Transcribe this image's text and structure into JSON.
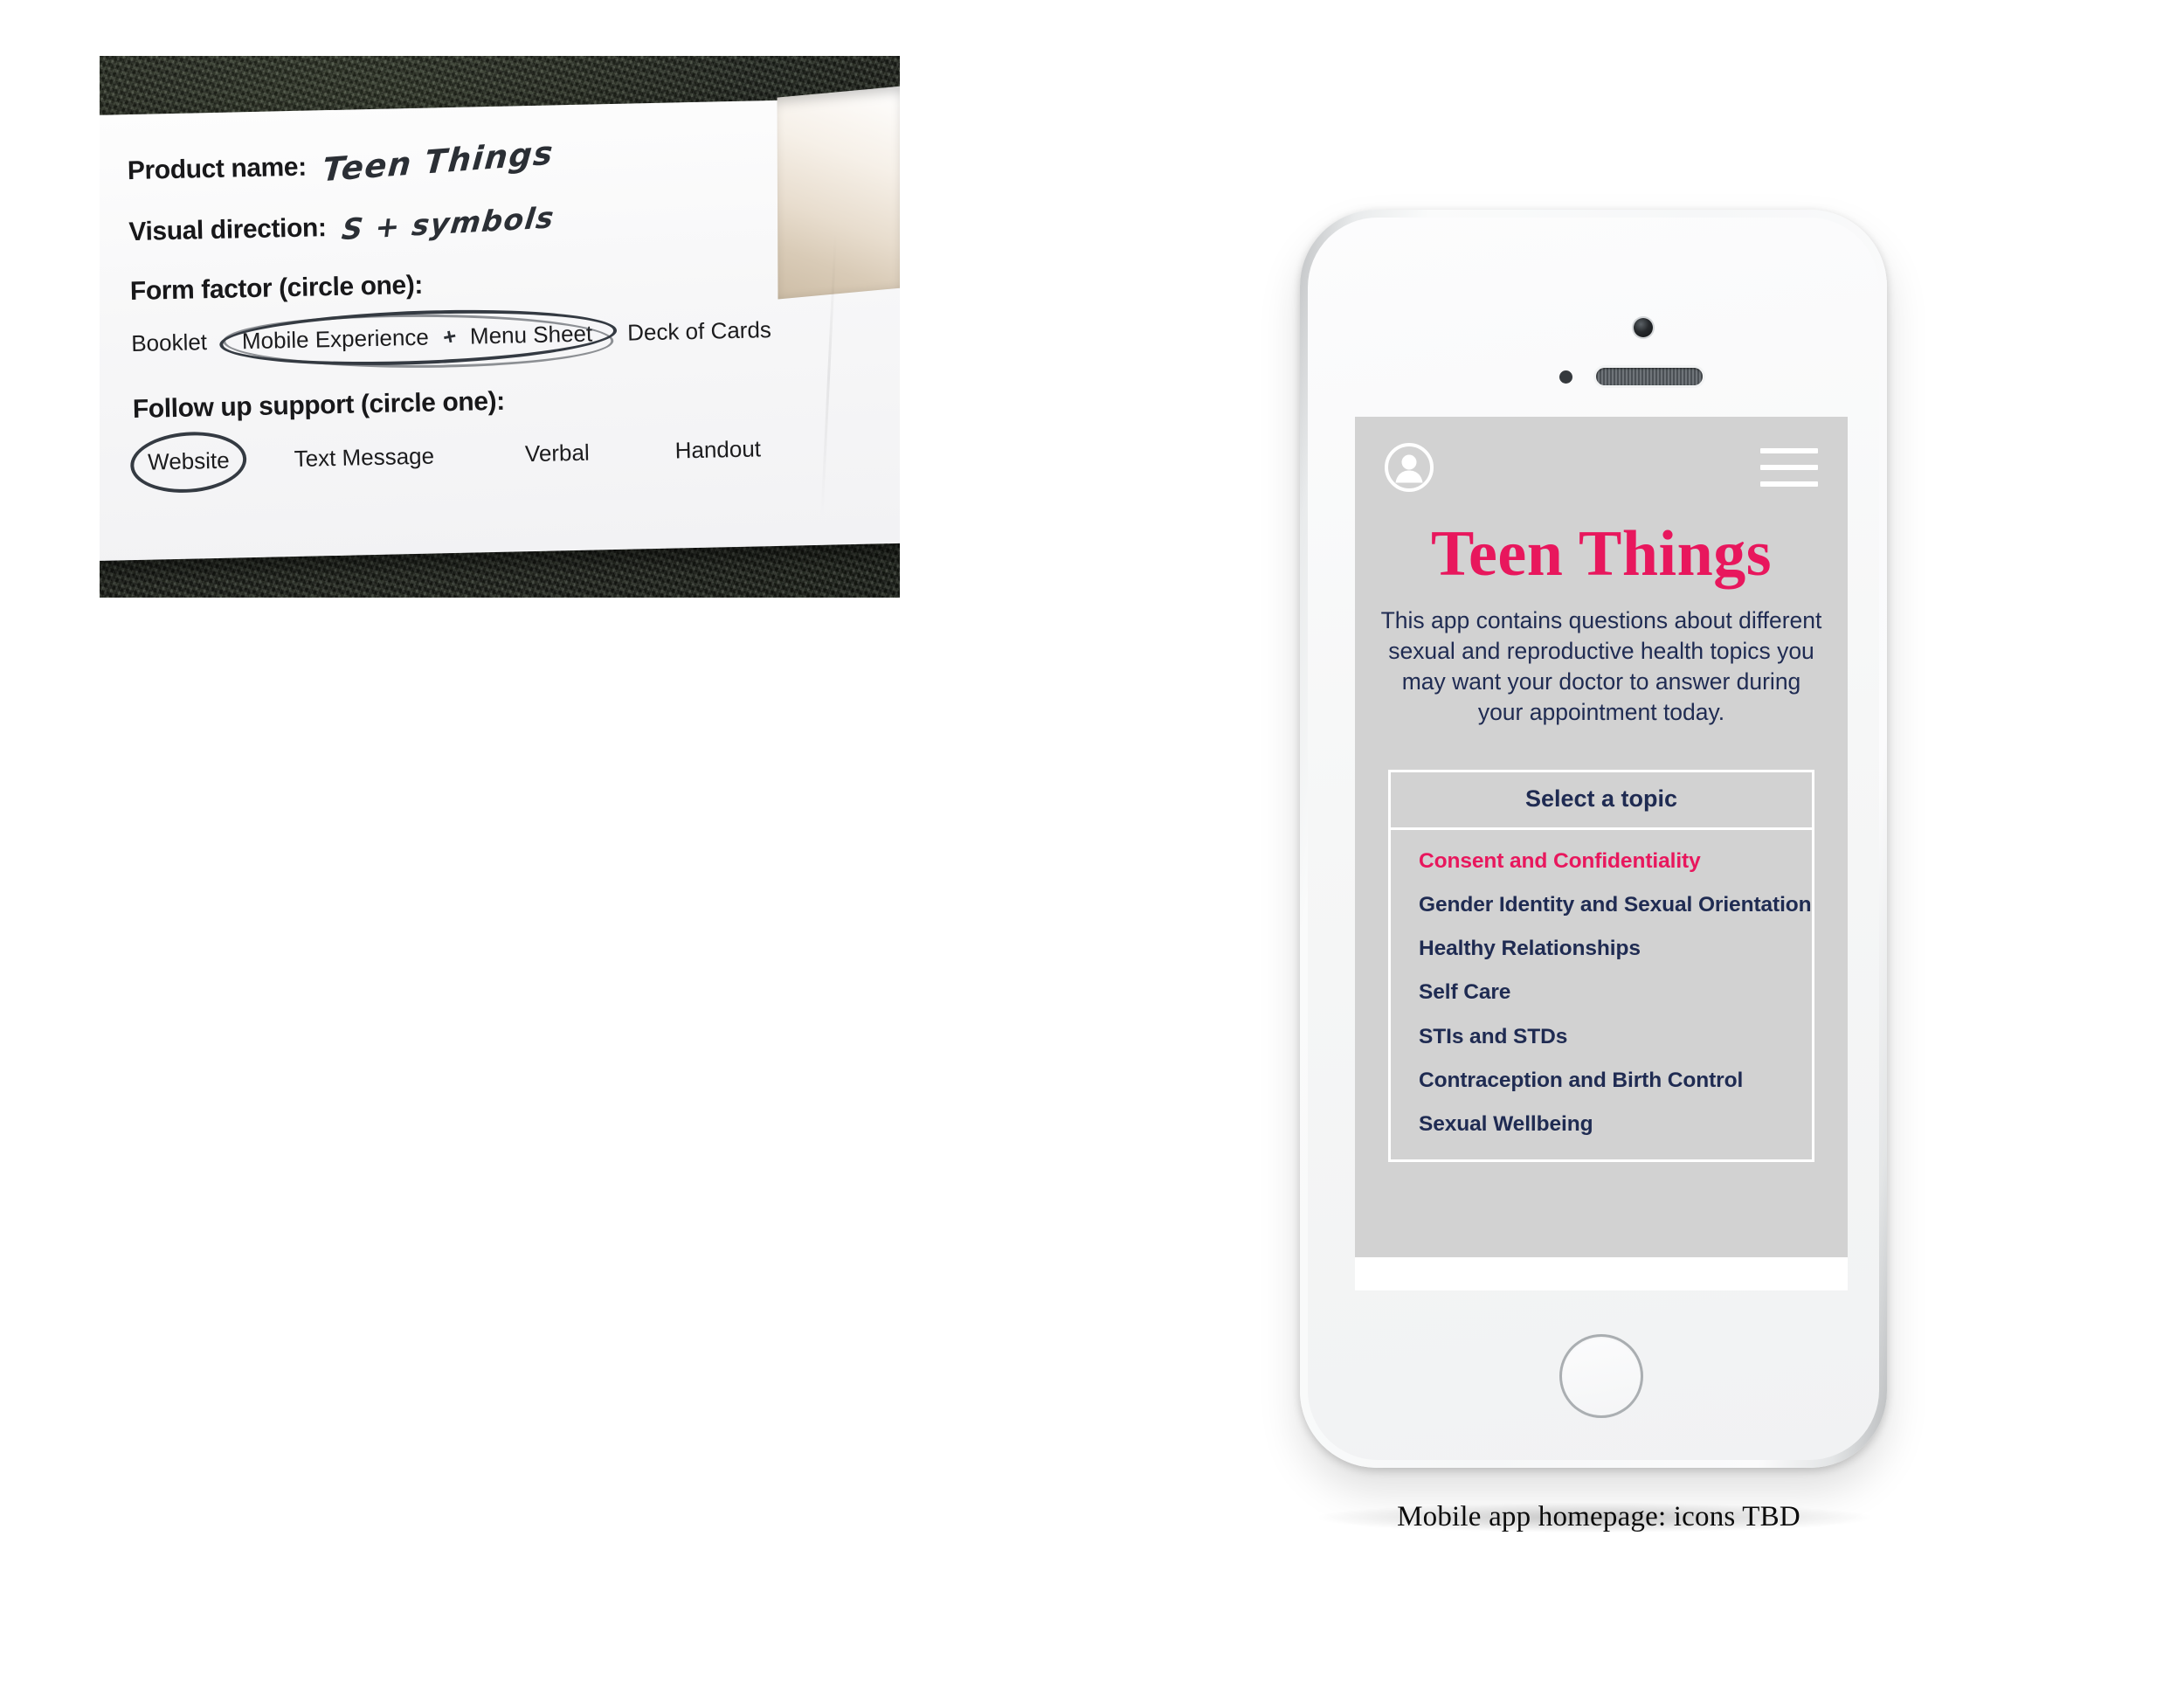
{
  "worksheet": {
    "fields": [
      {
        "label": "Product name:",
        "value": "Teen Things"
      },
      {
        "label": "Visual direction:",
        "value": "S + symbols"
      }
    ],
    "form_factor": {
      "heading": "Form factor (circle one):",
      "options": [
        "Booklet",
        "Mobile Experience",
        "Menu Sheet",
        "Deck of Cards"
      ],
      "connector": "+",
      "circled": [
        "Mobile Experience",
        "Menu Sheet"
      ]
    },
    "follow_up": {
      "heading": "Follow up support (circle one):",
      "options": [
        "Website",
        "Text Message",
        "Verbal",
        "Handout"
      ],
      "circled": [
        "Website"
      ]
    }
  },
  "phone": {
    "app": {
      "avatar_icon": "user-avatar-icon",
      "menu_icon": "hamburger-menu-icon",
      "title": "Teen Things",
      "description": "This app contains questions about different sexual and reproductive health topics you may want your doctor to answer during your appointment today.",
      "topic_card": {
        "header": "Select a topic",
        "topics": [
          {
            "label": "Consent and Confidentiality",
            "active": true
          },
          {
            "label": "Gender Identity and Sexual Orientation",
            "active": false
          },
          {
            "label": "Healthy Relationships",
            "active": false
          },
          {
            "label": "Self Care",
            "active": false
          },
          {
            "label": "STIs and STDs",
            "active": false
          },
          {
            "label": "Contraception and Birth Control",
            "active": false
          },
          {
            "label": "Sexual Wellbeing",
            "active": false
          }
        ]
      }
    },
    "hardware": {
      "power_button": "power-button",
      "mute_switch": "mute-switch",
      "volume_up": "volume-up-button",
      "volume_down": "volume-down-button",
      "home_button": "home-button",
      "front_camera": "front-camera",
      "proximity_sensor": "proximity-sensor",
      "earpiece_speaker": "earpiece-speaker"
    }
  },
  "caption": "Mobile app homepage: icons TBD",
  "colors": {
    "accent_pink": "#E8175D",
    "text_navy": "#1F2B52",
    "screen_grey": "#d2d2d2",
    "page_background": "#ffffff"
  }
}
